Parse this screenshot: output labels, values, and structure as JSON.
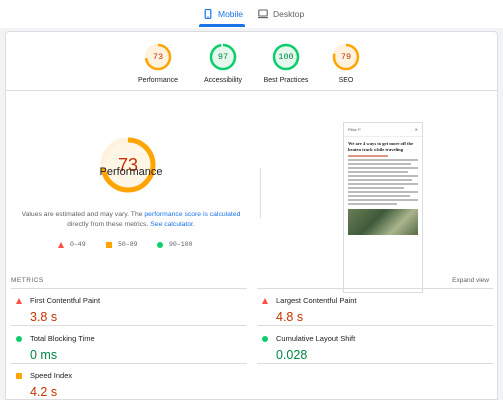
{
  "tabs": [
    {
      "label": "Mobile",
      "icon": "mobile-icon",
      "active": true
    },
    {
      "label": "Desktop",
      "icon": "desktop-icon",
      "active": false
    }
  ],
  "summary_scores": [
    {
      "label": "Performance",
      "score": 73,
      "status": "average",
      "color": "#ffa400"
    },
    {
      "label": "Accessibility",
      "score": 97,
      "status": "pass",
      "color": "#0cce6b"
    },
    {
      "label": "Best Practices",
      "score": 100,
      "status": "pass",
      "color": "#0cce6b"
    },
    {
      "label": "SEO",
      "score": 79,
      "status": "average",
      "color": "#ffa400"
    }
  ],
  "performance": {
    "score": 73,
    "title": "Performance",
    "desc_prefix": "Values are estimated and may vary. The",
    "desc_link1": "performance score is calculated",
    "desc_middle": "directly from these metrics.",
    "desc_link2": "See calculator."
  },
  "legend": [
    {
      "shape": "triangle",
      "range": "0–49"
    },
    {
      "shape": "square",
      "range": "50–89"
    },
    {
      "shape": "circle",
      "range": "90–100"
    }
  ],
  "preview": {
    "logo": "Pillar P",
    "title": "We are 4 ways to get more off the beaten track while traveling"
  },
  "metrics": {
    "header": "METRICS",
    "expand_label": "Expand view",
    "items": [
      {
        "name": "First Contentful Paint",
        "value": "3.8 s",
        "status": "fail"
      },
      {
        "name": "Largest Contentful Paint",
        "value": "4.8 s",
        "status": "fail"
      },
      {
        "name": "Total Blocking Time",
        "value": "0 ms",
        "status": "pass"
      },
      {
        "name": "Cumulative Layout Shift",
        "value": "0.028",
        "status": "pass"
      },
      {
        "name": "Speed Index",
        "value": "4.2 s",
        "status": "average"
      }
    ]
  },
  "colors": {
    "accent": "#1a73e8",
    "fail": "#ff4e42",
    "average": "#ffa400",
    "pass": "#0cce6b"
  }
}
